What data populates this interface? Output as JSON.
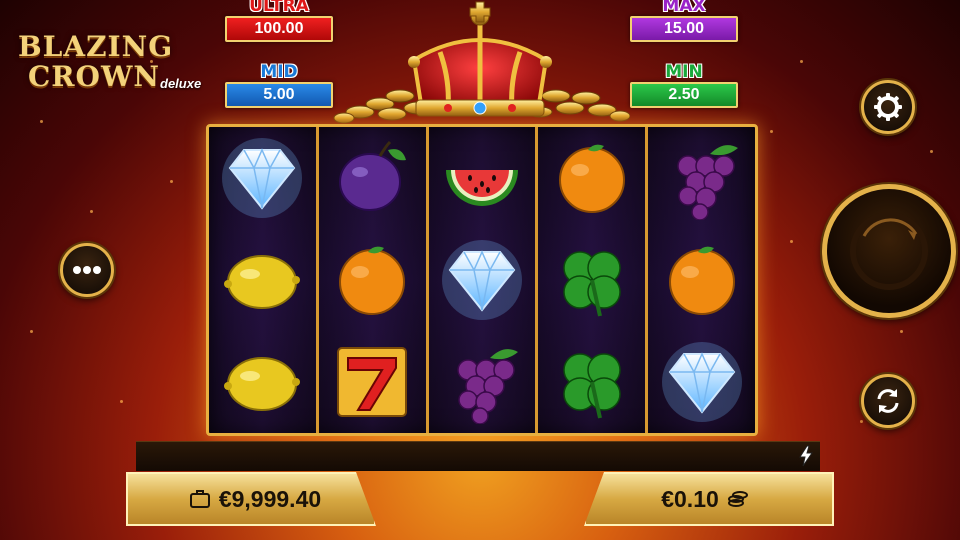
{
  "game": {
    "logo_line1": "BLAZING",
    "logo_line2": "CROWN",
    "logo_line3": "deluxe"
  },
  "jackpots": {
    "ultra": {
      "label": "ULTRA",
      "value": "100.00",
      "color": "#e01818"
    },
    "mid": {
      "label": "MID",
      "value": "5.00",
      "color": "#1a7ad8"
    },
    "max": {
      "label": "MAX",
      "value": "15.00",
      "color": "#9a22c8"
    },
    "min": {
      "label": "MIN",
      "value": "2.50",
      "color": "#1aa83a"
    }
  },
  "reels": [
    [
      "diamond",
      "lemon",
      "lemon"
    ],
    [
      "plum",
      "orange",
      "seven"
    ],
    [
      "watermelon",
      "diamond",
      "grapes"
    ],
    [
      "orange",
      "clover",
      "clover"
    ],
    [
      "grapes",
      "orange",
      "diamond"
    ]
  ],
  "footer": {
    "balance": "€9,999.40",
    "bet": "€0.10",
    "balance_icon": "briefcase-icon",
    "bet_icon": "coins-icon"
  },
  "controls": {
    "menu_icon": "ellipsis-icon",
    "settings_icon": "gear-icon",
    "spin_icon": "spin-arrow-icon",
    "autoplay_icon": "autoplay-icon"
  },
  "colors": {
    "accent_gold": "#e4b24a",
    "background_red": "#9a1e0a"
  }
}
